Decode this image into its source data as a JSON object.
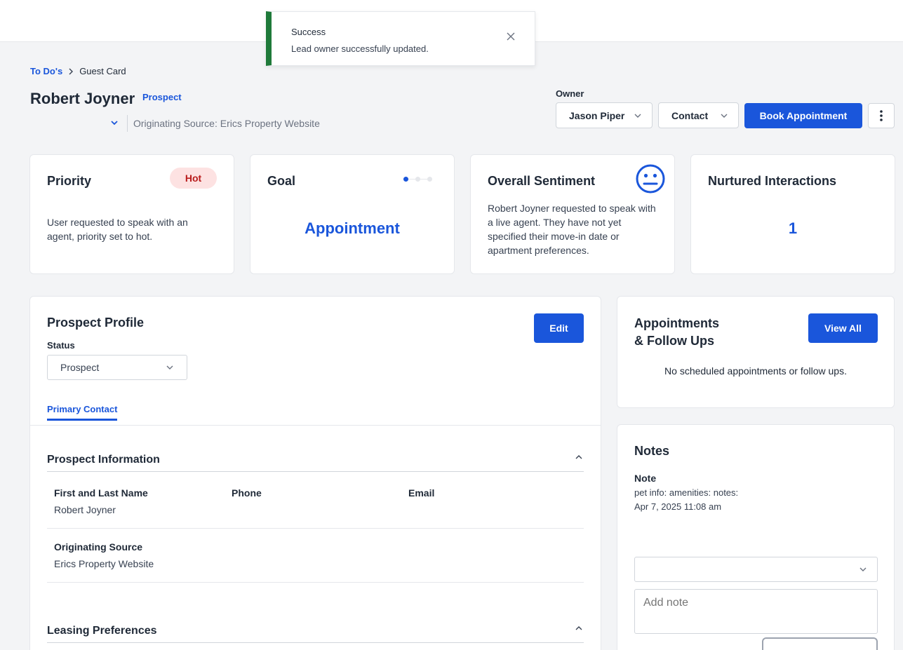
{
  "toast": {
    "title": "Success",
    "message": "Lead owner successfully updated."
  },
  "breadcrumb": {
    "parent": "To Do's",
    "current": "Guest Card"
  },
  "lead": {
    "name": "Robert Joyner",
    "badge": "Prospect",
    "originating_source": "Originating Source: Erics Property Website"
  },
  "header_actions": {
    "owner_label": "Owner",
    "owner_value": "Jason Piper",
    "contact_label": "Contact",
    "book_label": "Book Appointment"
  },
  "priority": {
    "title": "Priority",
    "level": "Hot",
    "description": "User requested to speak with an agent, priority set to hot."
  },
  "goal": {
    "title": "Goal",
    "value": "Appointment",
    "step": 1,
    "steps": 3
  },
  "sentiment": {
    "title": "Overall Sentiment",
    "icon": "neutral-face-icon",
    "description": "Robert Joyner requested to speak with a live agent. They have not yet specified their move-in date or apartment preferences."
  },
  "nurtured": {
    "title": "Nurtured Interactions",
    "value": "1"
  },
  "profile": {
    "title": "Prospect Profile",
    "edit_label": "Edit",
    "status_label": "Status",
    "status_value": "Prospect",
    "tab_label": "Primary Contact",
    "info_heading": "Prospect Information",
    "fields": {
      "name_label": "First and Last Name",
      "name_value": "Robert Joyner",
      "phone_label": "Phone",
      "email_label": "Email",
      "source_label": "Originating Source",
      "source_value": "Erics Property Website"
    },
    "leasing_heading": "Leasing Preferences"
  },
  "appointments": {
    "title_line1": "Appointments",
    "title_line2": "& Follow Ups",
    "view_all_label": "View All",
    "empty_text": "No scheduled appointments or follow ups."
  },
  "notes": {
    "title": "Notes",
    "note_label": "Note",
    "note_text": "pet info: amenities: notes:",
    "note_date": "Apr 7, 2025 11:08 am",
    "add_placeholder": "Add note"
  },
  "colors": {
    "primary": "#1a56db",
    "success": "#1f7a3a",
    "hot_bg": "#fde2e2",
    "hot_text": "#b91c1c"
  }
}
